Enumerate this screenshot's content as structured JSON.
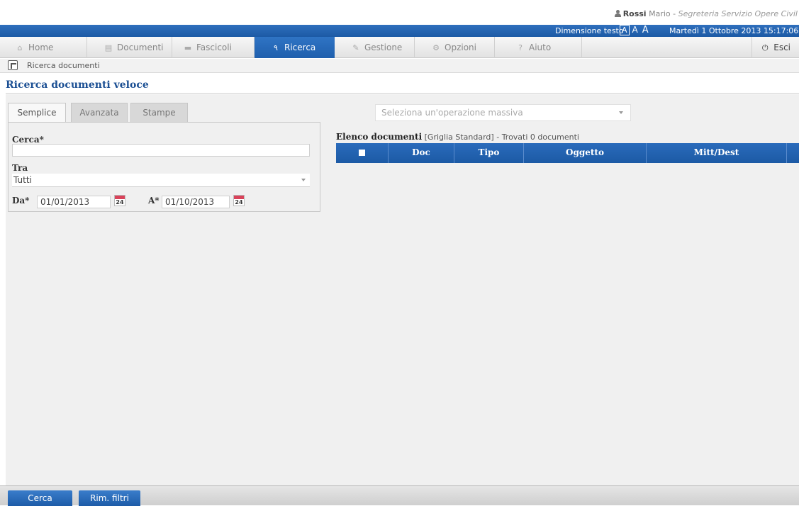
{
  "user": {
    "surname": "Rossi",
    "name": "Mario",
    "separator": "-",
    "role": "Segreteria Servizio Opere Civil"
  },
  "topbar": {
    "text_size_label": "Dimensione testo",
    "text_size_options": [
      "A",
      "A",
      "A"
    ],
    "datetime": "Martedì 1 Ottobre 2013 15:17:06"
  },
  "nav": {
    "tabs": [
      {
        "label": "Home",
        "icon": "home-icon",
        "glyph": "⌂"
      },
      {
        "label": "Documenti",
        "icon": "documents-icon",
        "glyph": "▤"
      },
      {
        "label": "Fascicoli",
        "icon": "folder-icon",
        "glyph": "▬"
      },
      {
        "label": "Ricerca",
        "icon": "search-icon",
        "glyph": "٩"
      },
      {
        "label": "Gestione",
        "icon": "pencil-icon",
        "glyph": "✎"
      },
      {
        "label": "Opzioni",
        "icon": "options-icon",
        "glyph": "⚙"
      },
      {
        "label": "Aiuto",
        "icon": "help-icon",
        "glyph": "?"
      }
    ],
    "active": "Ricerca",
    "exit_label": "Esci",
    "exit_glyph": "⏻"
  },
  "breadcrumb": "Ricerca documenti",
  "page_title": "Ricerca documenti veloce",
  "subtabs": [
    "Semplice",
    "Avanzata",
    "Stampe"
  ],
  "form": {
    "search_label": "Cerca*",
    "search_value": "",
    "among_label": "Tra",
    "among_value": "Tutti",
    "from_label": "Da*",
    "from_value": "01/01/2013",
    "to_label": "A*",
    "to_value": "01/10/2013",
    "calendar_day": "24"
  },
  "massive": {
    "placeholder": "Seleziona un'operazione massiva"
  },
  "list": {
    "title": "Elenco documenti",
    "grid_name": "[Griglia Standard]",
    "separator": "-",
    "found": "Trovati 0 documenti",
    "columns": [
      "Doc",
      "Tipo",
      "Oggetto",
      "Mitt/Dest"
    ]
  },
  "buttons": {
    "search": "Cerca",
    "clear": "Rim. filtri"
  },
  "colors": {
    "brand_blue": "#1c5aa5",
    "title_blue": "#1b4f93",
    "calendar_red": "#d9435a"
  }
}
